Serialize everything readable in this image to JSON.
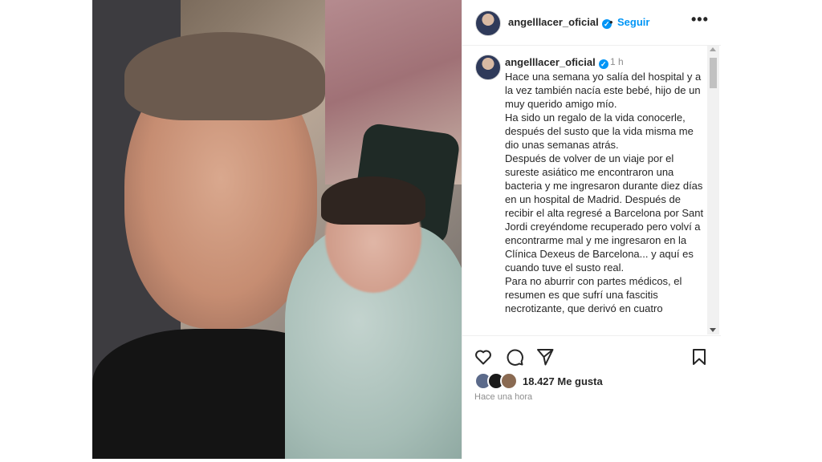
{
  "author": {
    "username": "angelllacer_oficial",
    "verified_icon": "verified-badge-icon",
    "follow_label": "Seguir",
    "separator": "•",
    "more_icon": "more-options-icon",
    "more_label": "•••"
  },
  "caption": {
    "username": "angelllacer_oficial",
    "time": "1 h",
    "paragraphs": [
      "Hace una semana yo salía del hospital y a la vez también nacía este bebé, hijo de un muy querido amigo mío.",
      "Ha sido un regalo de la vida conocerle, después del susto que la vida misma me dio unas semanas atrás.",
      "Después de volver de un viaje por el sureste asiático me encontraron una bacteria y me ingresaron durante diez días en un hospital de Madrid. Después de recibir el alta regresé a Barcelona por Sant Jordi creyéndome recuperado pero volví a encontrarme mal y me ingresaron en la Clínica Dexeus de Barcelona... y aquí es cuando tuve el susto real.",
      "Para no aburrir con partes médicos, el resumen es que sufrí una fascitis necrotizante, que derivó en cuatro"
    ]
  },
  "actions": {
    "like_icon": "heart-icon",
    "comment_icon": "comment-icon",
    "share_icon": "share-icon",
    "save_icon": "bookmark-icon"
  },
  "likes": {
    "count_text": "18.427 Me gusta",
    "avatars": [
      "#5b6a8a",
      "#1a1a1a",
      "#8a6a52"
    ]
  },
  "posted": "Hace una hora",
  "colors": {
    "accent": "#0095f6",
    "text": "#262626",
    "muted": "#8e8e8e"
  }
}
